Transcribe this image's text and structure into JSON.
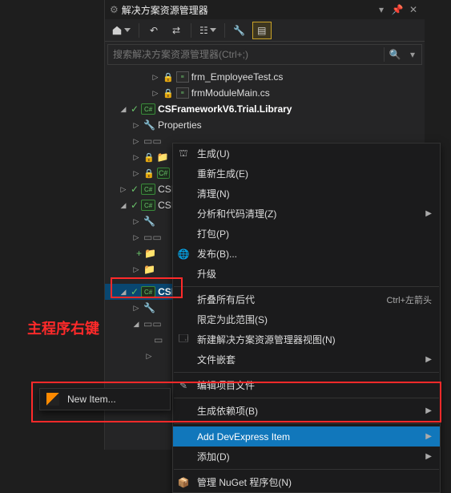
{
  "panel": {
    "title": "解决方案资源管理器",
    "search_placeholder": "搜索解决方案资源管理器(Ctrl+;)"
  },
  "tree": {
    "file1": "frm_EmployeeTest.cs",
    "file2": "frmModuleMain.cs",
    "proj_framework": "CSFrameworkV6.Trial.Library",
    "properties": "Properties",
    "cs_prefix": "CSI",
    "cs_badge": "C#"
  },
  "ctx": {
    "build": "生成(U)",
    "rebuild": "重新生成(E)",
    "clean": "清理(N)",
    "analyze": "分析和代码清理(Z)",
    "pack": "打包(P)",
    "publish": "发布(B)...",
    "upgrade": "升级",
    "collapse": "折叠所有后代",
    "collapse_shortcut": "Ctrl+左箭头",
    "scope": "限定为此范围(S)",
    "newview": "新建解决方案资源管理器视图(N)",
    "nesting": "文件嵌套",
    "editproj": "编辑项目文件",
    "builddep": "生成依赖项(B)",
    "adddev": "Add DevExpress Item",
    "add": "添加(D)",
    "nuget": "管理 NuGet 程序包(N)"
  },
  "submenu": {
    "newitem": "New Item..."
  },
  "annotation": {
    "text": "主程序右键"
  }
}
